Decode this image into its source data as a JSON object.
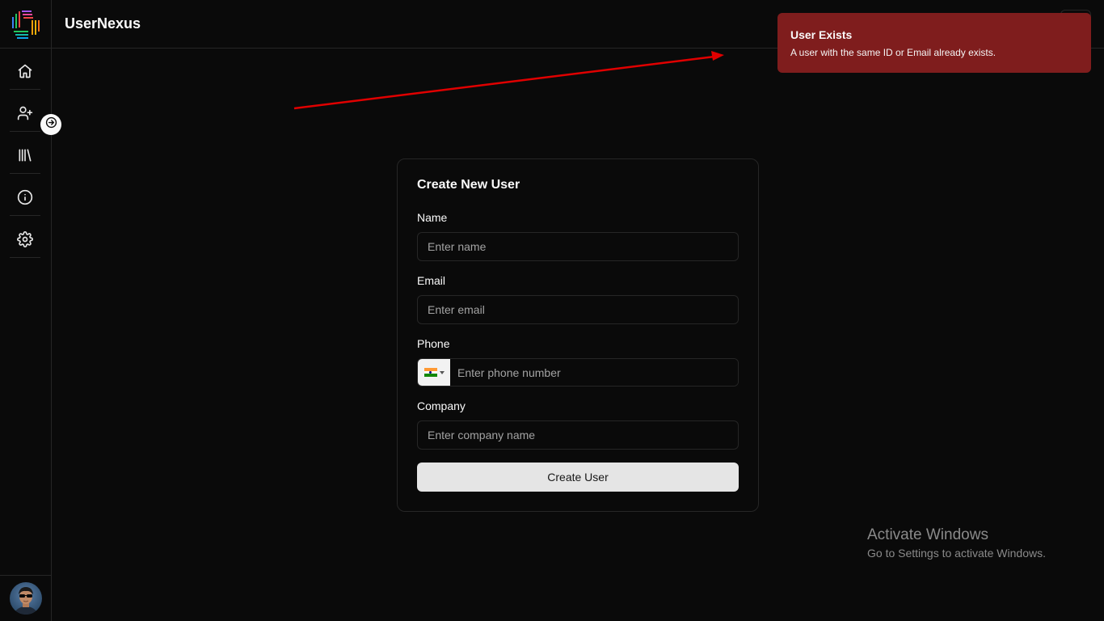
{
  "app": {
    "title": "UserNexus"
  },
  "sidebar": {
    "items": [
      {
        "icon": "home-icon"
      },
      {
        "icon": "user-plus-icon"
      },
      {
        "icon": "library-icon"
      },
      {
        "icon": "info-icon"
      },
      {
        "icon": "settings-icon"
      }
    ],
    "expand_icon": "arrow-right-icon"
  },
  "toast": {
    "title": "User Exists",
    "description": "A user with the same ID or Email already exists.",
    "color": "#7f1d1d"
  },
  "form": {
    "title": "Create New User",
    "name": {
      "label": "Name",
      "placeholder": "Enter name",
      "value": ""
    },
    "email": {
      "label": "Email",
      "placeholder": "Enter email",
      "value": ""
    },
    "phone": {
      "label": "Phone",
      "placeholder": "Enter phone number",
      "value": "",
      "country_flag": "india-flag-icon"
    },
    "company": {
      "label": "Company",
      "placeholder": "Enter company name",
      "value": ""
    },
    "submit_label": "Create User"
  },
  "watermark": {
    "title": "Activate Windows",
    "subtitle": "Go to Settings to activate Windows."
  },
  "colors": {
    "background": "#0a0a0a",
    "border": "#262626",
    "annotation_arrow": "#e00000"
  }
}
